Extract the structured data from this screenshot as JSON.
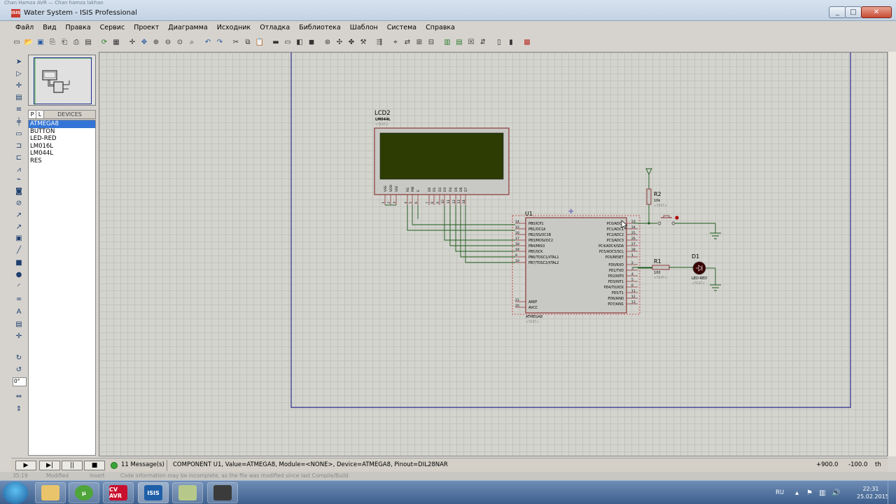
{
  "window": {
    "bg_title": "Chan Hamza AVR — Chan hamza lakhan",
    "title": "Water System - ISIS Professional",
    "app_icon": "ISIS",
    "min": "_",
    "max": "□",
    "close": "✕"
  },
  "menu": [
    "Файл",
    "Вид",
    "Правка",
    "Сервис",
    "Проект",
    "Диаграмма",
    "Исходник",
    "Отладка",
    "Библиотека",
    "Шаблон",
    "Система",
    "Справка"
  ],
  "devices": {
    "p_label": "P",
    "l_label": "L",
    "title": "DEVICES",
    "items": [
      "ATMEGA8",
      "BUTTON",
      "LED-RED",
      "LM016L",
      "LM044L",
      "RES"
    ],
    "selected": 0
  },
  "rotation": "0°",
  "schematic": {
    "lcd": {
      "ref": "LCD2",
      "value": "LM044L",
      "text": "<TEXT>",
      "screen_color": "#2c3c03",
      "pins": [
        "VSS",
        "VDD",
        "VEE",
        "RS",
        "RW",
        "E",
        "D0",
        "D1",
        "D2",
        "D3",
        "D4",
        "D5",
        "D6",
        "D7"
      ],
      "pin_numbers": [
        "1",
        "2",
        "3",
        "4",
        "5",
        "6",
        "7",
        "8",
        "9",
        "10",
        "11",
        "12",
        "13",
        "14"
      ]
    },
    "mcu": {
      "ref": "U1",
      "value": "ATMEGA8",
      "text": "<TEXT>",
      "left_pins": [
        {
          "num": "14",
          "name": "PB0/ICP1"
        },
        {
          "num": "15",
          "name": "PB1/OC1A"
        },
        {
          "num": "16",
          "name": "PB2/SS/OC1B"
        },
        {
          "num": "17",
          "name": "PB3/MOSI/OC2"
        },
        {
          "num": "18",
          "name": "PB4/MISO"
        },
        {
          "num": "19",
          "name": "PB5/SCK"
        },
        {
          "num": "9",
          "name": "PB6/TOSC1/XTAL1"
        },
        {
          "num": "10",
          "name": "PB7/TOSC2/XTAL2"
        }
      ],
      "aref": {
        "num": "21",
        "name": "AREF"
      },
      "avcc": {
        "num": "20",
        "name": "AVCC"
      },
      "right_pins": [
        {
          "num": "23",
          "name": "PC0/ADC0"
        },
        {
          "num": "24",
          "name": "PC1/ADC1"
        },
        {
          "num": "25",
          "name": "PC2/ADC2"
        },
        {
          "num": "26",
          "name": "PC3/ADC3"
        },
        {
          "num": "27",
          "name": "PC4/ADC4/SDA"
        },
        {
          "num": "28",
          "name": "PC5/ADC5/SCL"
        },
        {
          "num": "1",
          "name": "PC6/RESET"
        },
        {
          "num": "2",
          "name": "PD0/RXD"
        },
        {
          "num": "3",
          "name": "PD1/TXD"
        },
        {
          "num": "4",
          "name": "PD2/INT0"
        },
        {
          "num": "5",
          "name": "PD3/INT1"
        },
        {
          "num": "6",
          "name": "PD4/T0/XCK"
        },
        {
          "num": "11",
          "name": "PD5/T1"
        },
        {
          "num": "12",
          "name": "PD6/AIN0"
        },
        {
          "num": "13",
          "name": "PD7/AIN1"
        }
      ]
    },
    "r2": {
      "ref": "R2",
      "value": "10k",
      "text": "<TEXT>"
    },
    "r1": {
      "ref": "R1",
      "value": "100",
      "text": "<TEXT>"
    },
    "d1": {
      "ref": "D1",
      "value": "LED-RED",
      "text": "<TEXT>"
    }
  },
  "status": {
    "play": "▶",
    "step": "▶|",
    "pause": "||",
    "stop": "■",
    "messages": "11 Message(s)",
    "text": "COMPONENT U1, Value=ATMEGA8, Module=<NONE>, Device=ATMEGA8, Pinout=DIL28NAR",
    "x": "+900.0",
    "y": "-100.0",
    "unit": "th"
  },
  "ghost_status": {
    "position": "35:19",
    "modified": "Modified",
    "insert": "Insert",
    "notice": "Code information may be incomplete, as the file was modified since last Compile/Build"
  },
  "taskbar": {
    "apps": [
      "",
      "µ",
      "CV AVR",
      "ISIS",
      "",
      ""
    ],
    "lang": "RU",
    "time": "22:31",
    "date": "25.02.2015"
  },
  "colors": {
    "selection": "#3375d6",
    "sheet_border": "#2c2c8a",
    "wire": "#1a5a1a",
    "component_outline": "#8a3a3a",
    "led_body": "#3a0000"
  }
}
